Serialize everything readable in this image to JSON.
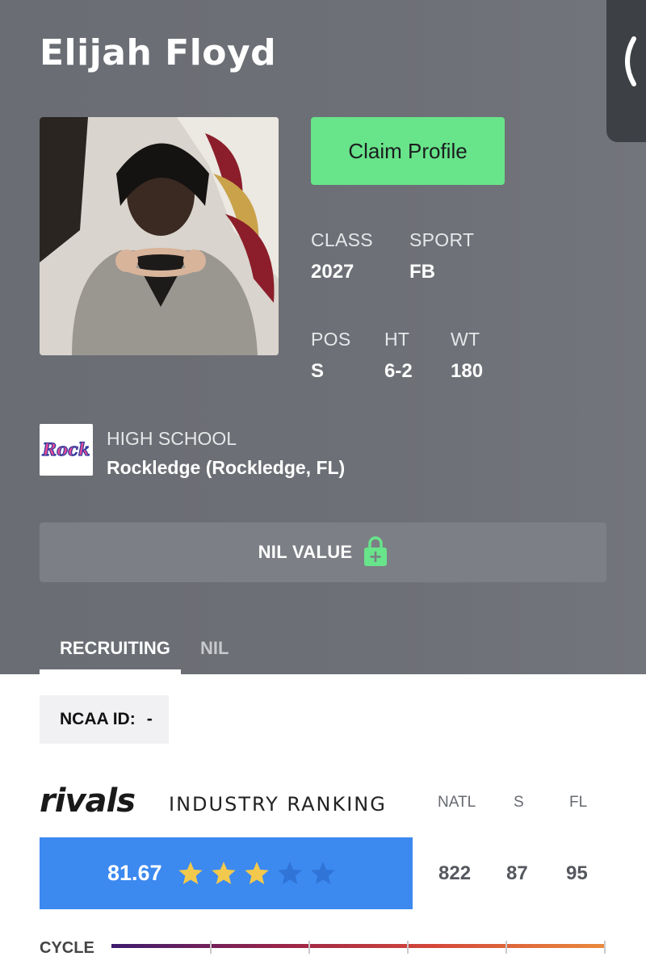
{
  "player": {
    "name": "Elijah Floyd"
  },
  "actions": {
    "claim_label": "Claim Profile"
  },
  "stats": {
    "class_label": "CLASS",
    "class_value": "2027",
    "sport_label": "SPORT",
    "sport_value": "FB",
    "pos_label": "POS",
    "pos_value": "S",
    "ht_label": "HT",
    "ht_value": "6-2",
    "wt_label": "WT",
    "wt_value": "180"
  },
  "school": {
    "label": "HIGH SCHOOL",
    "value": "Rockledge (Rockledge, FL)",
    "logo_text": "Rock"
  },
  "nil": {
    "label": "NIL VALUE",
    "icon": "lock-icon"
  },
  "tabs": [
    {
      "label": "RECRUITING",
      "active": true
    },
    {
      "label": "NIL",
      "active": false
    }
  ],
  "ncaa": {
    "label": "NCAA ID:",
    "value": "-"
  },
  "ranking": {
    "brand": "rivals",
    "title": "INDUSTRY RANKING",
    "columns": [
      "NATL",
      "S",
      "FL"
    ],
    "values": [
      "822",
      "87",
      "95"
    ],
    "score": "81.67",
    "stars": 3,
    "max_stars": 5
  },
  "cycle": {
    "label": "CYCLE"
  },
  "colors": {
    "accent_green": "#68e48a",
    "rating_blue": "#3c89f0",
    "star_filled": "#f2c94c",
    "star_empty": "#2f74d6"
  }
}
